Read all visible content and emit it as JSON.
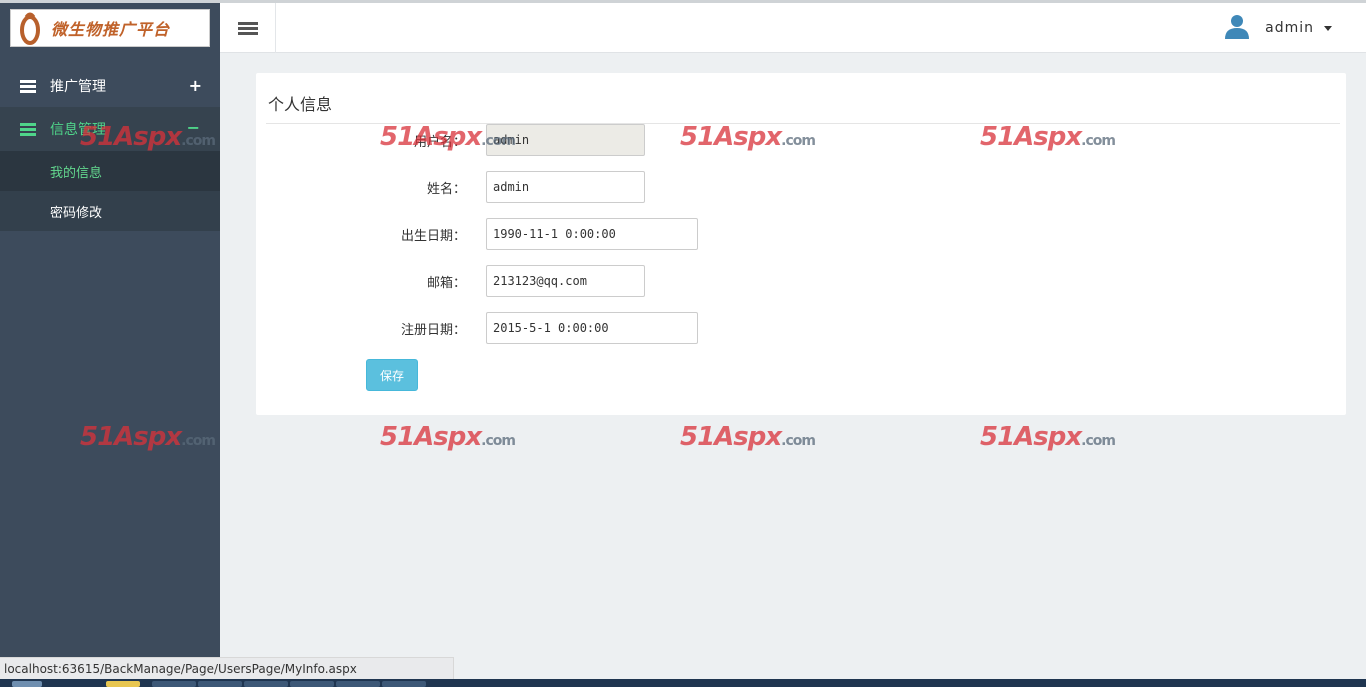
{
  "app": {
    "logo_text": "微生物推广平台",
    "user_name": "admin"
  },
  "sidebar": {
    "promo": {
      "label": "推广管理",
      "toggle": "+"
    },
    "info": {
      "label": "信息管理",
      "toggle": "−"
    },
    "subitems": [
      {
        "label": "我的信息",
        "active": true
      },
      {
        "label": "密码修改",
        "active": false
      }
    ]
  },
  "panel": {
    "title": "个人信息",
    "fields": [
      {
        "label": "用户名：",
        "value": "admin",
        "readonly": true
      },
      {
        "label": "姓名：",
        "value": "admin",
        "readonly": false
      },
      {
        "label": "出生日期：",
        "value": "1990-11-1 0:00:00",
        "readonly": false
      },
      {
        "label": "邮箱：",
        "value": "213123@qq.com",
        "readonly": false
      },
      {
        "label": "注册日期：",
        "value": "2015-5-1 0:00:00",
        "readonly": false
      }
    ],
    "save_label": "保存"
  },
  "watermark": {
    "main": "51Aspx",
    "suffix": ".com"
  },
  "statusbar": {
    "url": "localhost:63615/BackManage/Page/UsersPage/MyInfo.aspx"
  },
  "colors": {
    "sidebar": "#3d4b5c",
    "accent_green": "#4fd58a",
    "button": "#5bc0de",
    "watermark": "#d9323a"
  }
}
